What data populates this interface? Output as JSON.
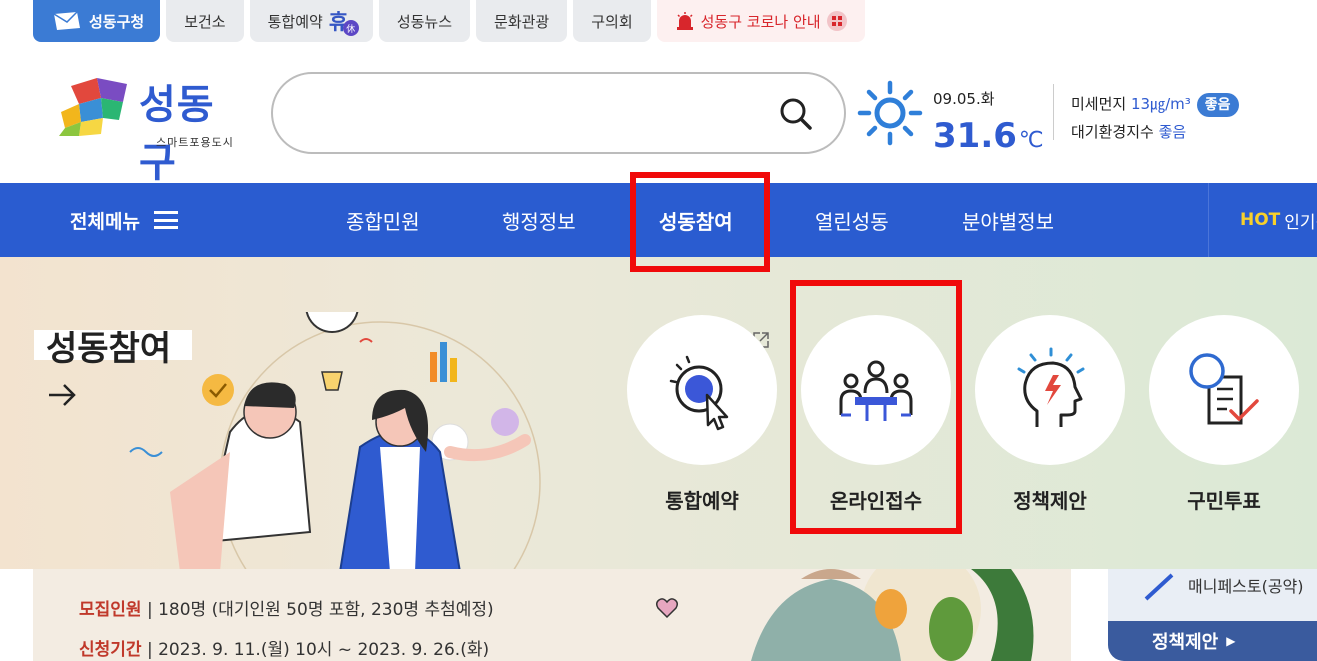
{
  "site_tabs": [
    {
      "label": "성동구청",
      "active": true,
      "icon": "envelope-icon"
    },
    {
      "label": "보건소"
    },
    {
      "label": "통합예약",
      "badge_char": "휴",
      "badge_sub": "休"
    },
    {
      "label": "성동뉴스"
    },
    {
      "label": "문화관광"
    },
    {
      "label": "구의회"
    },
    {
      "label": "성동구 코로나 안내",
      "icon": "siren-icon"
    }
  ],
  "header": {
    "logo_name": "성동구",
    "logo_sub": "스마트포용도시",
    "search": {
      "placeholder": "",
      "value": ""
    }
  },
  "weather": {
    "date": "09.05.화",
    "temp": "31.6",
    "unit": "℃",
    "icon": "sun-icon",
    "dust_label": "미세먼지",
    "dust_value": "13㎍/m³",
    "dust_badge": "좋음",
    "cai_label": "대기환경지수",
    "cai_value": "좋음"
  },
  "nav": {
    "all_menu": "전체메뉴",
    "items": [
      "종합민원",
      "행정정보",
      "성동참여",
      "열린성동",
      "분야별정보"
    ],
    "active_index": 2,
    "hot_tag": "HOT",
    "hot_text": "인기검"
  },
  "mega": {
    "title": "성동참여",
    "items": [
      {
        "label": "통합예약",
        "icon": "reservation-click-icon",
        "external": true
      },
      {
        "label": "온라인접수",
        "icon": "meeting-people-icon"
      },
      {
        "label": "정책제안",
        "icon": "idea-head-icon"
      },
      {
        "label": "구민투표",
        "icon": "vote-check-icon"
      }
    ]
  },
  "banner": {
    "rows": [
      {
        "label": "",
        "text": ""
      },
      {
        "label": "모집인원",
        "text": " | 180명 (대기인원 50명 포함, 230명 추첨예정)"
      },
      {
        "label": "신청기간",
        "text": " | 2023. 9. 11.(월) 10시 ~ 2023. 9. 26.(화)"
      }
    ]
  },
  "side": {
    "manifesto": "매니페스토(공약)",
    "policy": "정책제안"
  },
  "colors": {
    "brand_blue": "#2a5cd0",
    "highlight_red": "#f00a0a",
    "covid_red": "#d8262c"
  }
}
